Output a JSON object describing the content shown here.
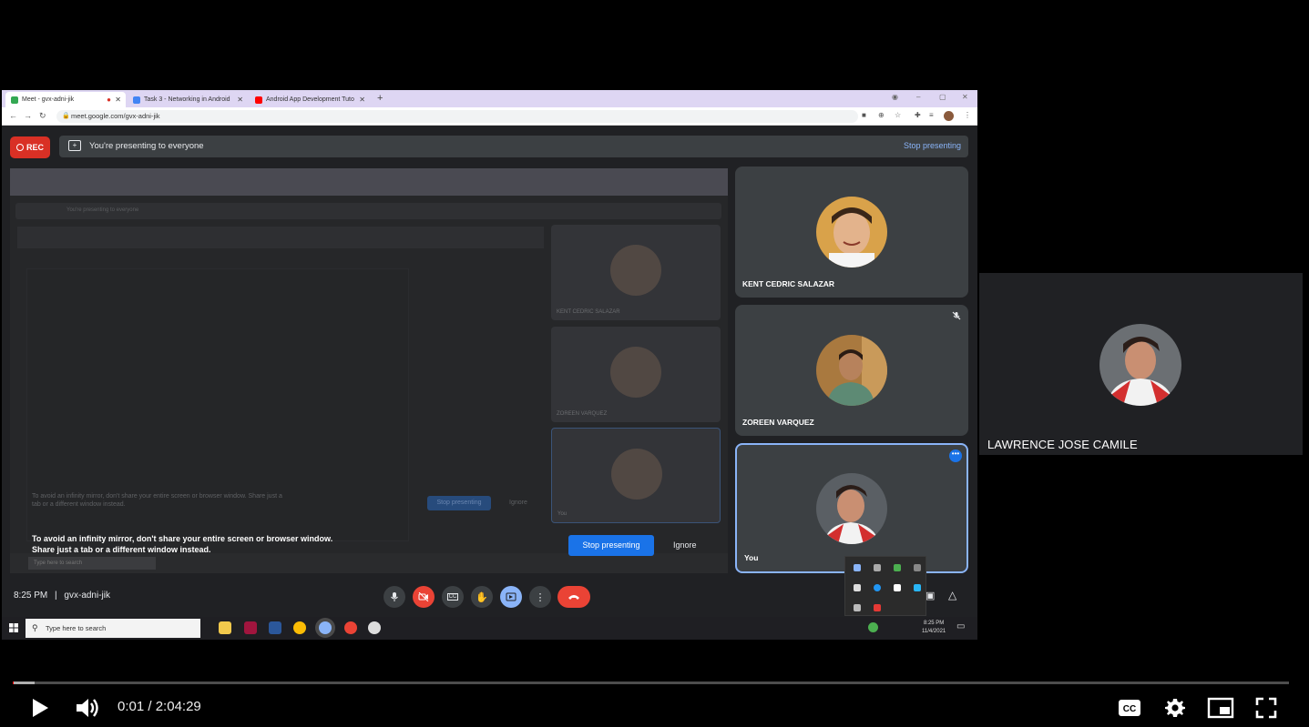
{
  "browser": {
    "tabs": [
      {
        "label": "Meet - gvx-adni-jik",
        "active": true,
        "favicon_color": "#34a853"
      },
      {
        "label": "Task 3 - Networking in Android",
        "active": false,
        "favicon_color": "#4285f4"
      },
      {
        "label": "Android App Development Tuto",
        "active": false,
        "favicon_color": "#ff0000"
      }
    ],
    "url": "meet.google.com/gvx-adni-jik"
  },
  "meet": {
    "rec_label": "REC",
    "presenting_text": "You're presenting to everyone",
    "stop_presenting_link": "Stop presenting",
    "warning": "To avoid an infinity mirror, don't share your entire screen or browser window. Share just a tab or a different window instead.",
    "stop_presenting_button": "Stop presenting",
    "ignore_button": "Ignore",
    "time": "8:25 PM",
    "separator": "|",
    "meeting_code": "gvx-adni-jik",
    "participants": [
      {
        "name": "KENT CEDRIC SALAZAR",
        "muted": false
      },
      {
        "name": "ZOREEN VARQUEZ",
        "muted": true
      },
      {
        "name": "You",
        "muted": false,
        "pinned_more": true
      }
    ]
  },
  "mirror": {
    "names": [
      "KENT CEDRIC SALAZAR",
      "ZOREEN VARQUEZ",
      "You"
    ],
    "warning": "To avoid an infinity mirror, don't share your entire screen or browser window. Share just a tab or a different window instead.",
    "stop": "Stop presenting",
    "ignore": "Ignore",
    "presenting": "You're presenting to everyone"
  },
  "taskbar": {
    "search_placeholder": "Type here to search",
    "clock_time": "8:25 PM",
    "clock_date": "11/4/2021"
  },
  "side_participant": {
    "name": "LAWRENCE JOSE CAMILE"
  },
  "player": {
    "current_time": "0:01",
    "duration": "2:04:29",
    "time_separator": " / ",
    "progress_played": 0.001,
    "progress_loaded": 0.017,
    "icons": [
      "play-icon",
      "volume-icon",
      "captions-icon",
      "settings-icon",
      "miniplayer-icon",
      "fullscreen-icon"
    ]
  },
  "colors": {
    "meet_bg": "#202124",
    "tile_bg": "#3c4043",
    "accent_blue": "#1a73e8",
    "rec_red": "#d93025",
    "progress_red": "#ff0000"
  }
}
